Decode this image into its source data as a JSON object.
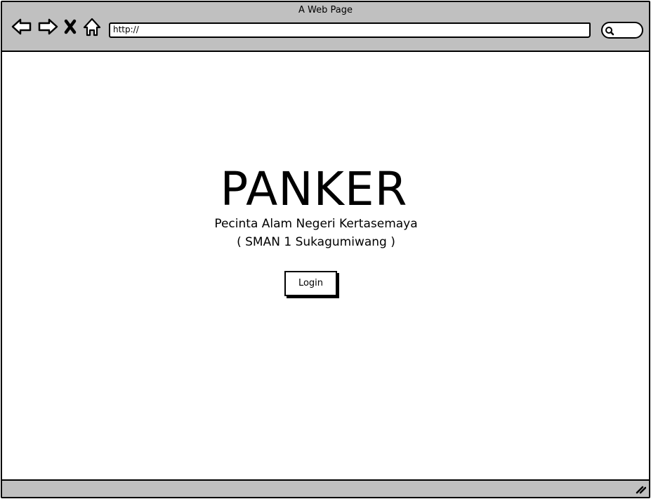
{
  "browser": {
    "window_title": "A Web Page",
    "address_bar": {
      "value": "http://"
    },
    "nav_icons": [
      "back-arrow-icon",
      "forward-arrow-icon",
      "close-x-icon",
      "home-icon"
    ],
    "search_icon": "magnifier-icon",
    "resize_icon": "resize-grip-icon"
  },
  "page": {
    "title": "PANKER",
    "subtitle_line1": "Pecinta Alam Negeri Kertasemaya",
    "subtitle_line2": "( SMAN 1 Sukagumiwang )",
    "login_label": "Login"
  },
  "colors": {
    "chrome": "#c0c0c0",
    "border": "#000000",
    "background": "#ffffff"
  }
}
